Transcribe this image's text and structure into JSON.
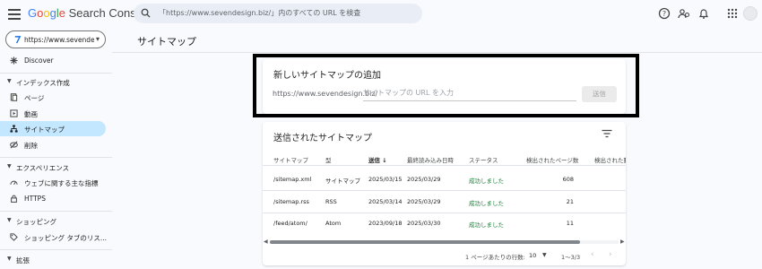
{
  "app": {
    "logo_google": "Google",
    "logo_product": "Search Console",
    "search_placeholder": "「https://www.sevendesign.biz/」内のすべての URL を検査"
  },
  "sidebar": {
    "property": "https://www.sevendesi...",
    "items": [
      {
        "label": "Discover",
        "icon": "asterisk-icon"
      },
      {
        "label": "ページ",
        "icon": "pages-icon"
      },
      {
        "label": "動画",
        "icon": "video-icon"
      },
      {
        "label": "サイトマップ",
        "icon": "sitemap-icon",
        "active": true
      },
      {
        "label": "削除",
        "icon": "removal-icon"
      },
      {
        "label": "ウェブに関する主な指標",
        "icon": "gauge-icon"
      },
      {
        "label": "HTTPS",
        "icon": "lock-icon"
      },
      {
        "label": "ショッピング タブのリス...",
        "icon": "tag-icon"
      }
    ],
    "sections": [
      "インデックス作成",
      "エクスペリエンス",
      "ショッピング",
      "拡張"
    ]
  },
  "page": {
    "title": "サイトマップ"
  },
  "add_card": {
    "title": "新しいサイトマップの追加",
    "prefix": "https://www.sevendesign.biz/",
    "input_placeholder": "サイトマップの URL を入力",
    "submit_label": "送信"
  },
  "list_card": {
    "title": "送信されたサイトマップ",
    "columns": [
      "サイトマップ",
      "型",
      "送信",
      "最終読み込み日時",
      "ステータス",
      "検出されたページ数",
      "検出された動"
    ],
    "sort_arrow": "↓",
    "rows": [
      {
        "sitemap": "/sitemap.xml",
        "type": "サイトマップ",
        "submitted": "2025/03/15",
        "last_read": "2025/03/29",
        "status": "成功しました",
        "pages": "608"
      },
      {
        "sitemap": "/sitemap.rss",
        "type": "RSS",
        "submitted": "2025/03/14",
        "last_read": "2025/03/29",
        "status": "成功しました",
        "pages": "21"
      },
      {
        "sitemap": "/feed/atom/",
        "type": "Atom",
        "submitted": "2023/09/18",
        "last_read": "2025/03/30",
        "status": "成功しました",
        "pages": "11"
      }
    ],
    "pager": {
      "rows_per_page_label": "1 ページあたりの行数:",
      "rows_per_page": "10",
      "range": "1～3/3"
    }
  },
  "colors": {
    "accent": "#1a73e8",
    "active_nav": "#c2e7ff",
    "success": "#188038",
    "highlight_border": "#000000"
  }
}
